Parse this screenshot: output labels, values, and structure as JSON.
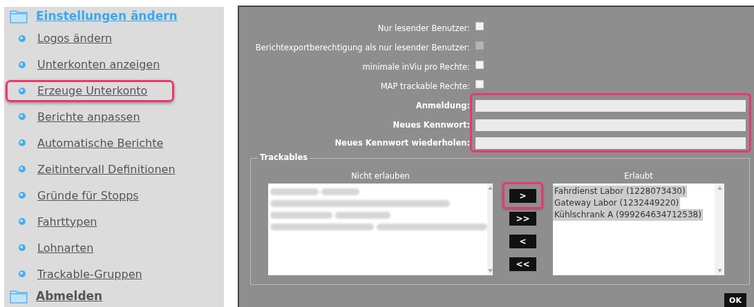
{
  "sidebar": {
    "header": {
      "label": "Einstellungen ändern"
    },
    "items": [
      {
        "label": "Logos ändern",
        "highlighted": false
      },
      {
        "label": "Unterkonten anzeigen",
        "highlighted": false
      },
      {
        "label": "Erzeuge Unterkonto",
        "highlighted": true
      },
      {
        "label": "Berichte anpassen",
        "highlighted": false
      },
      {
        "label": "Automatische Berichte",
        "highlighted": false
      },
      {
        "label": "Zeitintervall Definitionen",
        "highlighted": false
      },
      {
        "label": "Gründe für Stopps",
        "highlighted": false
      },
      {
        "label": "Fahrttypen",
        "highlighted": false
      },
      {
        "label": "Lohnarten",
        "highlighted": false
      },
      {
        "label": "Trackable-Gruppen",
        "highlighted": false
      }
    ],
    "footer": {
      "label": "Abmelden"
    }
  },
  "form": {
    "checkboxes": [
      {
        "label": "Nur lesender Benutzer:",
        "checked": false,
        "disabled": false
      },
      {
        "label": "Berichtexportberechtigung als nur lesender Benutzer:",
        "checked": false,
        "disabled": true
      },
      {
        "label": "minimale inViu pro Rechte:",
        "checked": false,
        "disabled": false
      },
      {
        "label": "MAP trackable Rechte:",
        "checked": false,
        "disabled": false
      }
    ],
    "credentials_highlighted": true,
    "fields": [
      {
        "label": "Anmeldung:"
      },
      {
        "label": "Neues Kennwort:"
      },
      {
        "label": "Neues Kennwort wiederholen:"
      }
    ]
  },
  "trackables": {
    "legend": "Trackables",
    "not_allowed": {
      "title": "Nicht erlauben"
    },
    "allowed": {
      "title": "Erlaubt",
      "items": [
        {
          "label": "Fahrdienst Labor (1228073430)",
          "selected": true
        },
        {
          "label": "Gateway Labor (1232449220)",
          "selected": true
        },
        {
          "label": "Kühlschrank A (999264634712538)",
          "selected": true
        }
      ]
    },
    "buttons": [
      {
        "label": ">",
        "highlighted": true
      },
      {
        "label": ">>",
        "highlighted": false
      },
      {
        "label": "<",
        "highlighted": false
      },
      {
        "label": "<<",
        "highlighted": false
      }
    ]
  },
  "ok_button": {
    "label": "OK"
  }
}
